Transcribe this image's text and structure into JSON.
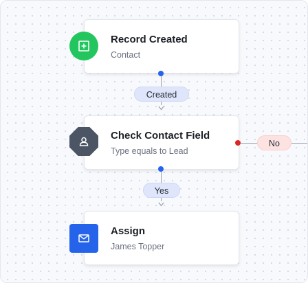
{
  "nodes": [
    {
      "title": "Record Created",
      "subtitle": "Contact",
      "icon": "plus-square-icon"
    },
    {
      "title": "Check Contact Field",
      "subtitle": "Type equals to Lead",
      "icon": "user-icon"
    },
    {
      "title": "Assign",
      "subtitle": "James Topper",
      "icon": "mail-icon"
    }
  ],
  "edges": {
    "created_label": "Created",
    "yes_label": "Yes",
    "no_label": "No"
  },
  "colors": {
    "trigger": "#22c55e",
    "condition": "#4b5563",
    "action": "#2563eb",
    "connector_dot": "#2563eb",
    "no_dot": "#dc2626",
    "branch_pill": "#dfe6fb",
    "no_pill": "#fde2e2"
  }
}
